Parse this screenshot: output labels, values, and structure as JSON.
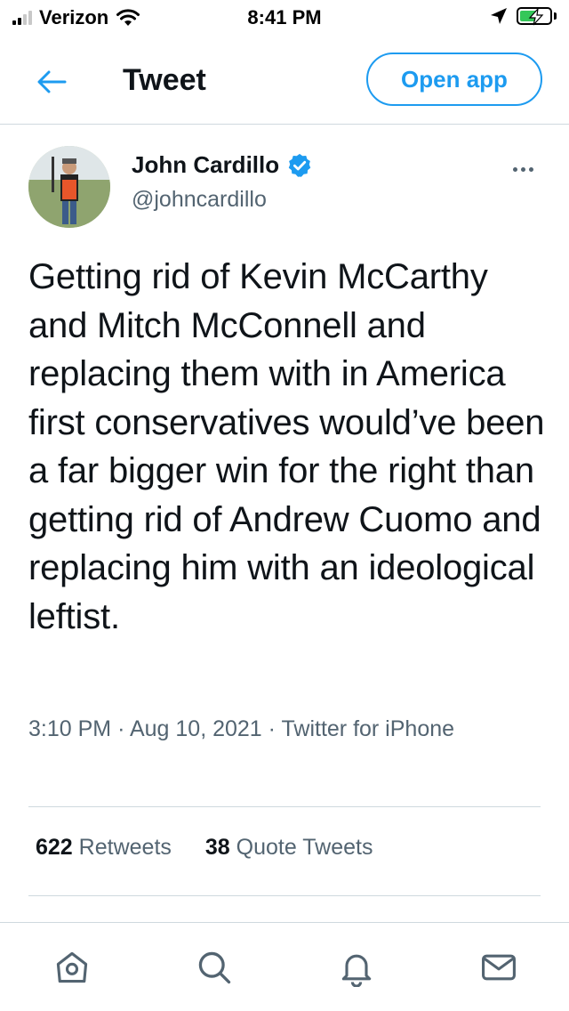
{
  "status_bar": {
    "carrier": "Verizon",
    "time": "8:41 PM",
    "battery_percent": 60
  },
  "header": {
    "title": "Tweet",
    "open_app_label": "Open app"
  },
  "tweet": {
    "author": {
      "display_name": "John Cardillo",
      "handle": "@johncardillo",
      "verified": true
    },
    "text": "Getting rid of Kevin McCarthy and Mitch McConnell and replacing them with in America first conservatives would’ve been a far bigger win for the right than getting rid of Andrew Cuomo and replacing him with an ideological leftist.",
    "time": "3:10 PM",
    "date": "Aug 10, 2021",
    "source": "Twitter for iPhone",
    "retweets_count": "622",
    "retweets_label": "Retweets",
    "quote_tweets_count": "38",
    "quote_tweets_label": "Quote Tweets"
  },
  "colors": {
    "accent": "#1d9bf0",
    "text_primary": "#0f1419",
    "text_secondary": "#536471",
    "divider": "#cfd9de",
    "battery_fill": "#34c759"
  },
  "icons": {
    "back": "arrow-left-icon",
    "verified": "verified-badge-icon",
    "more": "more-dots-icon",
    "tab_home": "home-icon",
    "tab_search": "search-icon",
    "tab_notifications": "bell-icon",
    "tab_messages": "mail-icon"
  }
}
